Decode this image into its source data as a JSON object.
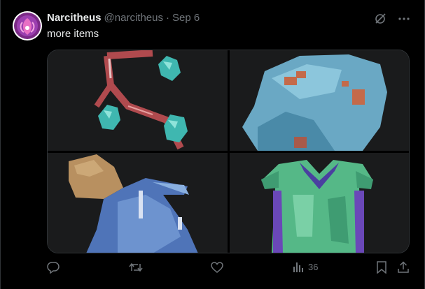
{
  "author": {
    "display_name": "Narcitheus",
    "handle": "@narcitheus",
    "separator": "·",
    "date": "Sep 6"
  },
  "tweet": {
    "text": "more items"
  },
  "media": {
    "images": [
      {
        "subject": "pixel-art branch with teal gems"
      },
      {
        "subject": "pixel-art blue stone with orange spots"
      },
      {
        "subject": "pixel-art blue potion bottle with cork"
      },
      {
        "subject": "pixel-art green tunic with purple trim"
      }
    ]
  },
  "actions": {
    "reply_icon": "reply-icon",
    "retweet_icon": "retweet-icon",
    "like_icon": "heart-icon",
    "views_icon": "views-chart-icon",
    "views_count": "36",
    "bookmark_icon": "bookmark-icon",
    "share_icon": "share-icon"
  },
  "colors": {
    "background": "#000000",
    "primary_text": "#e7e9ea",
    "secondary_text": "#71767b",
    "border": "#2f3336",
    "avatar_purple": "#7b2a86"
  }
}
